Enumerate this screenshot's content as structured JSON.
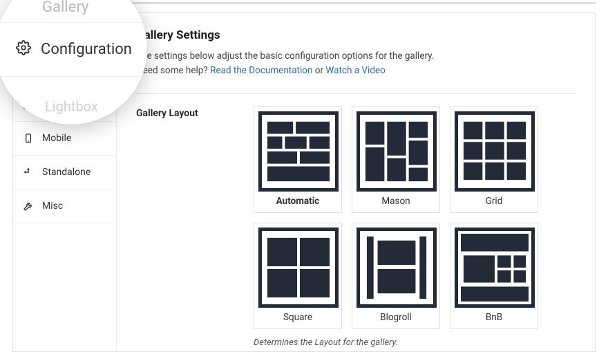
{
  "sidebar": {
    "items": [
      {
        "label": "Gallery"
      },
      {
        "label": "Configuration"
      },
      {
        "label": "Lightbox"
      },
      {
        "label": "Mobile"
      },
      {
        "label": "Standalone"
      },
      {
        "label": "Misc"
      }
    ]
  },
  "main": {
    "heading": "Gallery Settings",
    "desc_part1": "The settings below adjust the basic configuration options for the gallery.",
    "desc_part2_prefix": "Need some help? ",
    "link_docs": "Read the Documentation",
    "desc_or": " or ",
    "link_video": "Watch a Video",
    "field_label": "Gallery Layout",
    "helper": "Determines the Layout for the gallery."
  },
  "layouts": [
    {
      "label": "Automatic"
    },
    {
      "label": "Mason"
    },
    {
      "label": "Grid"
    },
    {
      "label": "Square"
    },
    {
      "label": "Blogroll"
    },
    {
      "label": "BnB"
    }
  ],
  "magnifier": {
    "gallery": "Gallery",
    "configuration": "Configuration",
    "lightbox": "Lightbox"
  }
}
